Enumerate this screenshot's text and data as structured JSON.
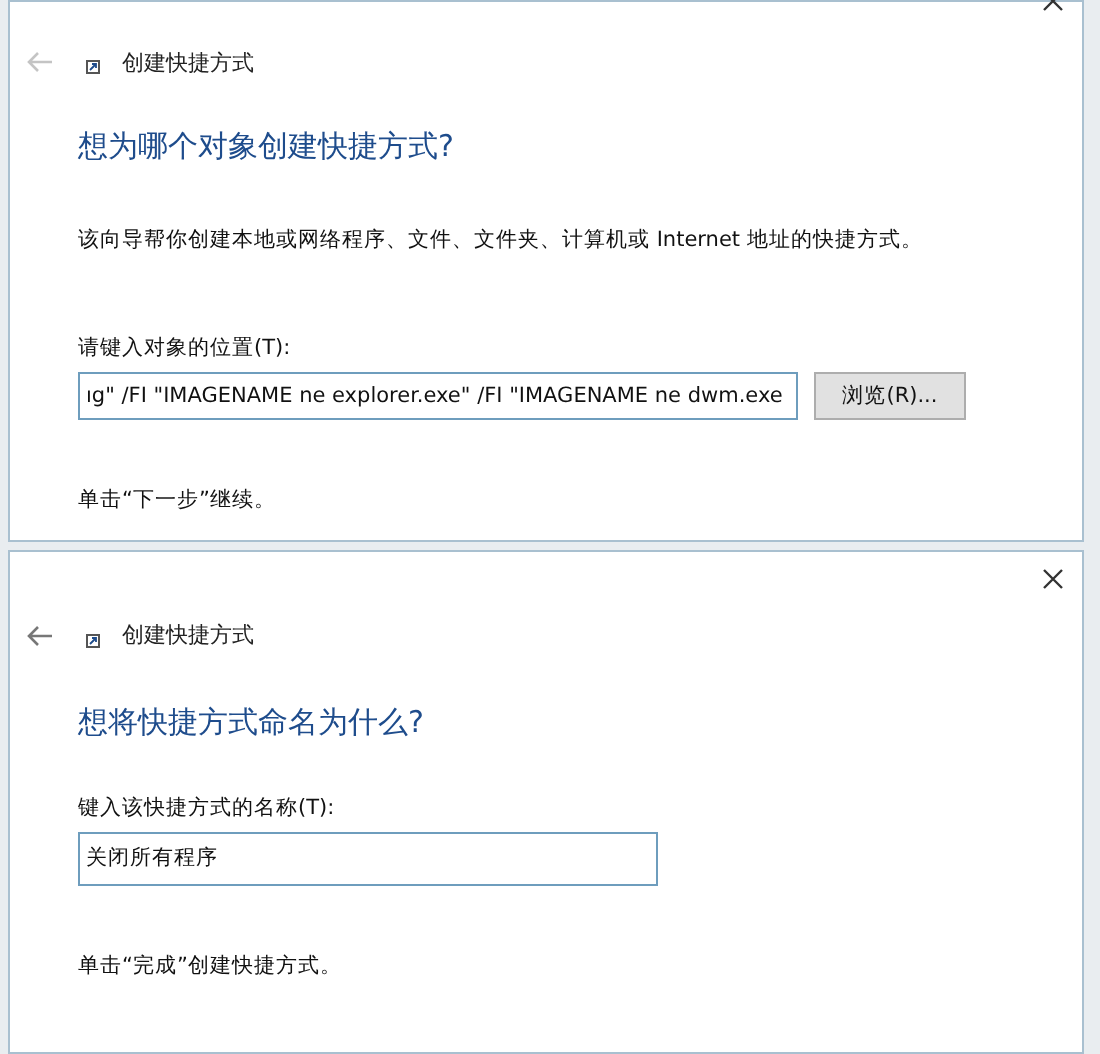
{
  "windows": [
    {
      "title": "创建快捷方式",
      "close_cut": true,
      "heading": "想为哪个对象创建快捷方式?",
      "description": "该向导帮你创建本地或网络程序、文件、文件夹、计算机或 Internet 地址的快捷方式。",
      "field_label": "请键入对象的位置(T):",
      "field_value": "ıg\" /FI \"IMAGENAME ne explorer.exe\" /FI \"IMAGENAME ne dwm.exe",
      "field_focused": true,
      "browse_button": "浏览(R)...",
      "footer": "单击“下一步”继续。"
    },
    {
      "title": "创建快捷方式",
      "close_cut": false,
      "heading": "想将快捷方式命名为什么?",
      "field_label": "键入该快捷方式的名称(T):",
      "field_value": "关闭所有程序",
      "field_focused": true,
      "footer": "单击“完成”创建快捷方式。"
    }
  ]
}
